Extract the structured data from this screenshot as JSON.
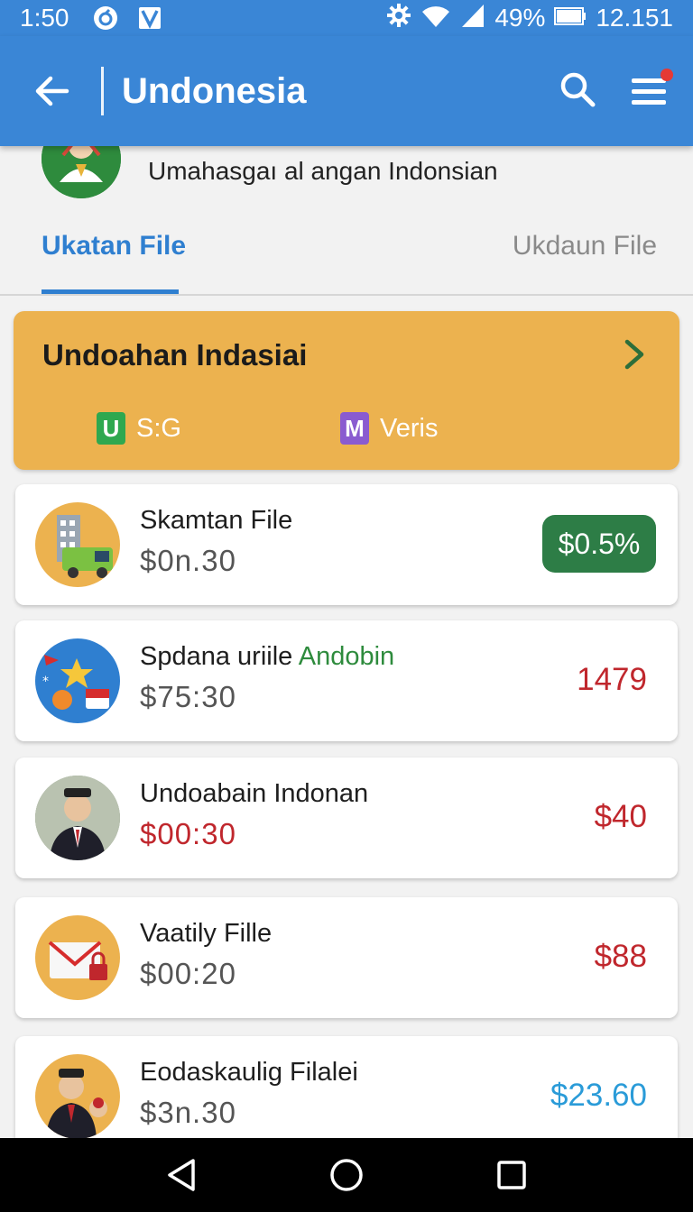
{
  "status_bar": {
    "time": "1:50",
    "battery": "49%",
    "extra": "12.151"
  },
  "app_bar": {
    "title": "Undonesia",
    "back_icon": "arrow-left-icon",
    "search_icon": "search-icon",
    "menu_icon": "hamburger-menu-icon",
    "notification_dot_color": "#e53935"
  },
  "profile": {
    "subtitle": "Umahasgaı al angan Indonsian"
  },
  "tabs": [
    {
      "label": "Ukatan File",
      "active": true
    },
    {
      "label": "Ukdaun File",
      "active": false
    }
  ],
  "featured": {
    "title": "Undoahan Indasiai",
    "meta": [
      {
        "badge": "U",
        "badge_color": "#2fa84f",
        "text": "S:G"
      },
      {
        "badge": "M",
        "badge_color": "#8a5bd0",
        "text": "Veris"
      }
    ],
    "background": "#ecb24f"
  },
  "items": [
    {
      "name": "Skamtan File",
      "name_highlight": "",
      "sub": "$0n.30",
      "sub_style": "gray",
      "value": "$0.5%",
      "value_style": "pill",
      "icon": "building-truck-icon"
    },
    {
      "name": "Spdana uriile ",
      "name_highlight": "Andobin",
      "sub": "$75:30",
      "sub_style": "gray",
      "value": "1479",
      "value_style": "red",
      "icon": "star-flag-icon"
    },
    {
      "name": "Undoabain Indonan",
      "name_highlight": "",
      "sub": "$00:30",
      "sub_style": "red",
      "value": "$40",
      "value_style": "red",
      "icon": "person-suit-icon"
    },
    {
      "name": "Vaatily Fille",
      "name_highlight": "",
      "sub": "$00:20",
      "sub_style": "gray",
      "value": "$88",
      "value_style": "red",
      "icon": "envelope-lock-icon"
    },
    {
      "name": "Eodaskaulig Filalei",
      "name_highlight": "",
      "sub": "$3n.30",
      "sub_style": "gray",
      "value": "$23.60",
      "value_style": "blue",
      "icon": "person-cap-icon"
    }
  ],
  "nav_bar": {
    "back": "nav-back-icon",
    "home": "nav-home-icon",
    "recents": "nav-recents-icon"
  },
  "colors": {
    "primary": "#3a86d6",
    "tab_active": "#2f7fd0",
    "positive_pill": "#2d7d46",
    "negative": "#c0272d",
    "info": "#2a9bd8"
  }
}
